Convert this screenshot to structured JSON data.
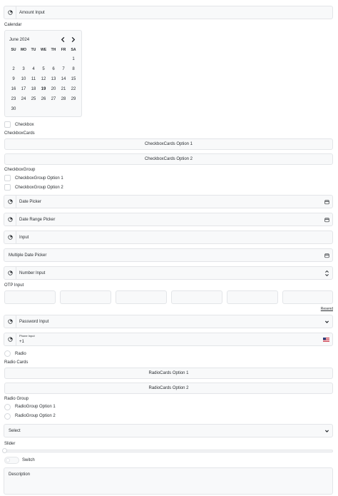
{
  "amount_input": {
    "placeholder": "Amount Input"
  },
  "calendar": {
    "label": "Calendar",
    "month": "June 2024",
    "weekdays": [
      "SU",
      "MO",
      "TU",
      "WE",
      "TH",
      "FR",
      "SA"
    ],
    "weeks": [
      [
        "",
        "",
        "",
        "",
        "",
        "",
        "1"
      ],
      [
        "2",
        "3",
        "4",
        "5",
        "6",
        "7",
        "8"
      ],
      [
        "9",
        "10",
        "11",
        "12",
        "13",
        "14",
        "15"
      ],
      [
        "16",
        "17",
        "18",
        "19",
        "20",
        "21",
        "22"
      ],
      [
        "23",
        "24",
        "25",
        "26",
        "27",
        "28",
        "29"
      ],
      [
        "30",
        "",
        "",
        "",
        "",
        "",
        ""
      ]
    ],
    "today": "19"
  },
  "checkbox": {
    "label": "Checkbox"
  },
  "checkbox_cards": {
    "label": "CheckboxCards",
    "options": [
      "CheckboxCards Option 1",
      "CheckboxCards Option 2"
    ]
  },
  "checkbox_group": {
    "label": "CheckboxGroup",
    "options": [
      "CheckboxGroup Option 1",
      "CheckboxGroup Option 2"
    ]
  },
  "date_picker": {
    "placeholder": "Date Picker"
  },
  "date_range_picker": {
    "placeholder": "Date Range Picker"
  },
  "input": {
    "placeholder": "Input"
  },
  "multiple_date_picker": {
    "placeholder": "Multiple Date Picker"
  },
  "number_input": {
    "placeholder": "Number Input"
  },
  "otp": {
    "label": "OTP Input",
    "resend": "Resend"
  },
  "password_input": {
    "placeholder": "Password Input"
  },
  "phone_input": {
    "label": "Phone Input",
    "value": "+1",
    "flag": "us-flag-icon"
  },
  "radio": {
    "label": "Radio"
  },
  "radio_cards": {
    "label": "Radio Cards",
    "options": [
      "RadioCards Option 1",
      "RadioCards Option 2"
    ]
  },
  "radio_group": {
    "label": "Radio Group",
    "options": [
      "RadioGroup Option 1",
      "RadioGroup Option 2"
    ]
  },
  "select": {
    "placeholder": "Select"
  },
  "slider": {
    "label": "Slider",
    "value": 0
  },
  "switch": {
    "label": "Switch",
    "on": false
  },
  "description": {
    "placeholder": "Description"
  },
  "colors": {
    "field_bg": "#f8f9fa",
    "border": "#e3e5e8",
    "text": "#2b2f33"
  }
}
